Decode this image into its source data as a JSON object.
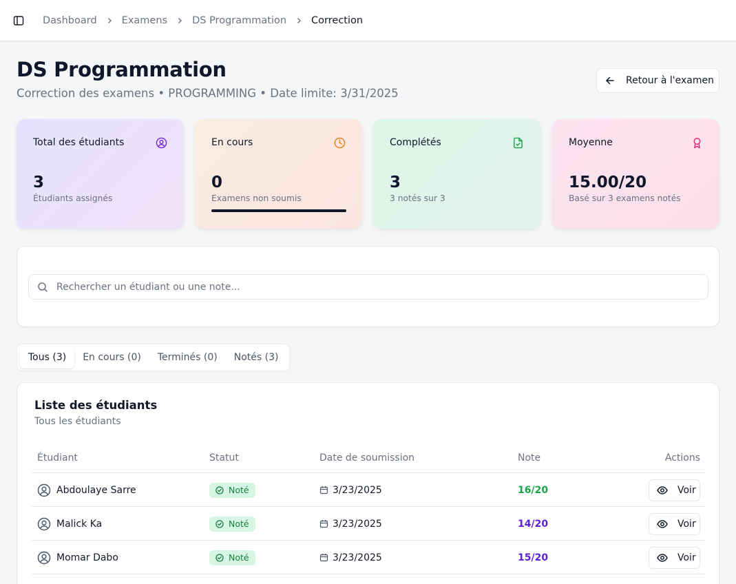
{
  "breadcrumb": {
    "items": [
      "Dashboard",
      "Examens",
      "DS Programmation"
    ],
    "current": "Correction"
  },
  "header": {
    "title": "DS Programmation",
    "subtitle": "Correction des examens • PROGRAMMING • Date limite: 3/31/2025",
    "back_label": "Retour à l'examen"
  },
  "stats": [
    {
      "label": "Total des étudiants",
      "value": "3",
      "desc": "Étudiants assignés",
      "icon": "user-circle-icon",
      "color": "#6d28d9"
    },
    {
      "label": "En cours",
      "value": "0",
      "desc": "Examens non soumis",
      "icon": "clock-icon",
      "color": "#ea7a12",
      "progress": 0
    },
    {
      "label": "Complétés",
      "value": "3",
      "desc": "3 notés sur 3",
      "icon": "file-check-icon",
      "color": "#16a34a"
    },
    {
      "label": "Moyenne",
      "value": "15.00/20",
      "desc": "Basé sur 3 examens notés",
      "icon": "award-icon",
      "color": "#db2777"
    }
  ],
  "search": {
    "placeholder": "Rechercher un étudiant ou une note..."
  },
  "tabs": [
    "Tous (3)",
    "En cours (0)",
    "Terminés (0)",
    "Notés (3)"
  ],
  "list": {
    "title": "Liste des étudiants",
    "subtitle": "Tous les étudiants",
    "columns": [
      "Étudiant",
      "Statut",
      "Date de soumission",
      "Note",
      "Actions"
    ],
    "rows": [
      {
        "name": "Abdoulaye Sarre",
        "status": "Noté",
        "date": "3/23/2025",
        "grade": "16/20",
        "grade_color": "#16a34a",
        "action": "Voir"
      },
      {
        "name": "Malick Ka",
        "status": "Noté",
        "date": "3/23/2025",
        "grade": "14/20",
        "grade_color": "#5b21d6",
        "action": "Voir"
      },
      {
        "name": "Momar Dabo",
        "status": "Noté",
        "date": "3/23/2025",
        "grade": "15/20",
        "grade_color": "#5b21d6",
        "action": "Voir"
      }
    ]
  }
}
